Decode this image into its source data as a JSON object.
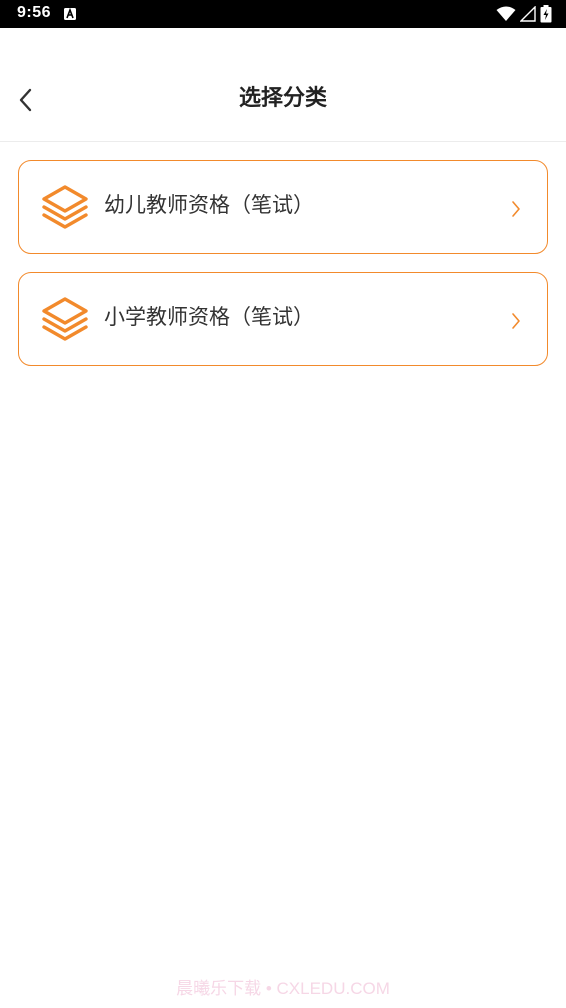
{
  "status_bar": {
    "time": "9:56",
    "icons": [
      "notification-a-icon",
      "wifi-icon",
      "signal-icon",
      "battery-icon"
    ]
  },
  "header": {
    "back_icon": "chevron-left-icon",
    "title": "选择分类"
  },
  "categories": [
    {
      "label": "幼儿教师资格（笔试）",
      "icon": "layers-icon",
      "chevron": "chevron-right-icon"
    },
    {
      "label": "小学教师资格（笔试）",
      "icon": "layers-icon",
      "chevron": "chevron-right-icon"
    }
  ],
  "watermark": "晨曦乐下载 • CXLEDU.COM",
  "colors": {
    "accent": "#f28a2c",
    "text": "#333333",
    "title": "#222222",
    "watermark": "#f6d7e6"
  }
}
